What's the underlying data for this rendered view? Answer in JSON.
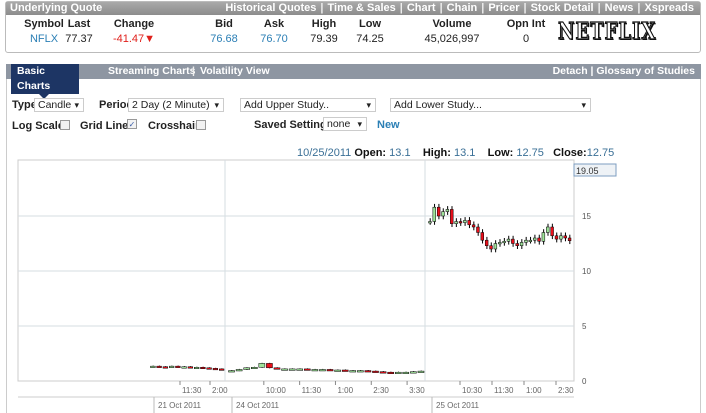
{
  "quote": {
    "title": "Underlying Quote",
    "links": [
      "Historical Quotes",
      "Time & Sales",
      "Chart",
      "Chain",
      "Pricer",
      "Stock Detail",
      "News",
      "Xspreads"
    ],
    "columns": [
      {
        "h": "Symbol",
        "v": "NFLX"
      },
      {
        "h": "Last",
        "v": "77.37"
      },
      {
        "h": "Change",
        "v": "-41.47"
      },
      {
        "h": "Bid",
        "v": "76.68"
      },
      {
        "h": "Ask",
        "v": "76.70"
      },
      {
        "h": "High",
        "v": "79.39"
      },
      {
        "h": "Low",
        "v": "74.25"
      },
      {
        "h": "Volume",
        "v": "45,026,997"
      },
      {
        "h": "Opn Int",
        "v": "0"
      }
    ],
    "logo": "NETFLIX",
    "down_arrow": "▼"
  },
  "tabs": {
    "items": [
      "Basic Charts",
      "Streaming Charts",
      "Volatility View"
    ],
    "right": "Detach | Glossary of Studies"
  },
  "controls": {
    "type_label": "Type",
    "type_value": "Candle",
    "period_label": "Period",
    "period_value": "2 Day (2 Minute)",
    "upper": "Add Upper Study..",
    "lower": "Add Lower Study...",
    "log_scale": "Log Scale",
    "grid_lines": "Grid Lines",
    "crosshair": "Crosshair",
    "saved_label": "Saved Settings:",
    "saved_value": "none",
    "new_label": "New",
    "checkmark": "✓"
  },
  "ohlc": {
    "date": "10/25/2011",
    "open_l": "Open:",
    "open": "13.1",
    "high_l": "High:",
    "high": "13.1",
    "low_l": "Low:",
    "low": "12.75",
    "close_l": "Close:",
    "close": "12.75"
  },
  "chart_data": {
    "type": "candlestick",
    "ylim": [
      0,
      20
    ],
    "yticks": [
      "0",
      "5",
      "10",
      "15"
    ],
    "cursor_value": "19.05",
    "time_labels": [
      [
        "11:30",
        "2:00"
      ],
      [
        "10:00",
        "11:30",
        "1:00",
        "2:30",
        "3:30"
      ],
      [
        "10:30",
        "11:30",
        "1:00",
        "2:30"
      ]
    ],
    "dates": [
      "21 Oct 2011",
      "24 Oct 2011",
      "25 Oct 2011"
    ],
    "days": [
      {
        "closes": [
          1.35,
          1.3,
          1.25,
          1.35,
          1.3,
          1.3,
          1.25,
          1.25,
          1.2,
          1.15,
          1.1,
          1.05
        ]
      },
      {
        "closes": [
          0.95,
          1.05,
          1.2,
          1.25,
          1.6,
          1.2,
          1.1,
          1.1,
          1.1,
          1.1,
          1.05,
          1.05,
          1.05,
          1.0,
          1.0,
          0.95,
          0.95,
          0.95,
          0.9,
          0.85,
          0.8,
          0.75,
          0.8,
          0.8,
          0.85,
          0.9
        ]
      },
      {
        "closes": [
          14.5,
          15.8,
          15.0,
          15.4,
          15.6,
          14.3,
          14.5,
          14.4,
          14.6,
          14.2,
          14.0,
          13.5,
          12.8,
          12.3,
          12.0,
          12.5,
          12.6,
          12.7,
          12.9,
          12.5,
          12.3,
          12.6,
          12.8,
          12.8,
          13.0,
          12.7,
          13.5,
          14.0,
          13.2,
          12.9,
          13.2,
          13.0,
          12.75
        ]
      }
    ]
  }
}
